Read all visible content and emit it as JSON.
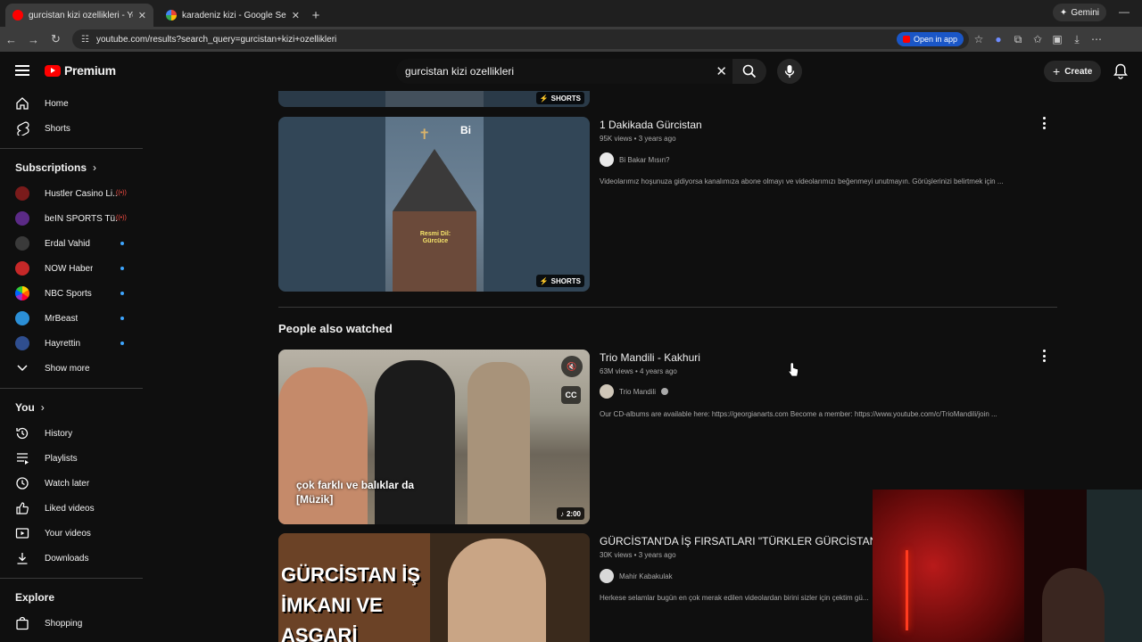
{
  "browser": {
    "tabs": [
      {
        "title": "gurcistan kizi ozellikleri - YouTube",
        "active": true
      },
      {
        "title": "karadeniz kizi - Google Search",
        "active": false
      }
    ],
    "gemini_label": "Gemini",
    "url": "youtube.com/results?search_query=gurcistan+kizi+ozellikleri",
    "open_in_app": "Open in app"
  },
  "header": {
    "logo_text": "Premium",
    "search_value": "gurcistan kizi ozellikleri",
    "create_label": "Create"
  },
  "sidebar": {
    "main": [
      {
        "label": "Home",
        "icon": "home-icon"
      },
      {
        "label": "Shorts",
        "icon": "shorts-icon"
      }
    ],
    "subscriptions_label": "Subscriptions",
    "subscriptions": [
      {
        "label": "Hustler Casino Li...",
        "color": "#7a1b1b",
        "status": "live"
      },
      {
        "label": "beIN SPORTS Tü...",
        "color": "#5b2a86",
        "status": "live"
      },
      {
        "label": "Erdal Vahid",
        "color": "#3a3a3a",
        "status": "new"
      },
      {
        "label": "NOW Haber",
        "color": "#c62828",
        "status": "new"
      },
      {
        "label": "NBC Sports",
        "color": "#2a2a2a",
        "status": "new"
      },
      {
        "label": "MrBeast",
        "color": "#2b8fd6",
        "status": "new"
      },
      {
        "label": "Hayrettin",
        "color": "#2f4e8f",
        "status": "new"
      }
    ],
    "show_more": "Show more",
    "you_label": "You",
    "you_items": [
      {
        "label": "History",
        "icon": "history-icon"
      },
      {
        "label": "Playlists",
        "icon": "playlists-icon"
      },
      {
        "label": "Watch later",
        "icon": "watch-later-icon"
      },
      {
        "label": "Liked videos",
        "icon": "like-icon"
      },
      {
        "label": "Your videos",
        "icon": "your-videos-icon"
      },
      {
        "label": "Downloads",
        "icon": "download-icon"
      }
    ],
    "explore_label": "Explore",
    "explore_items": [
      {
        "label": "Shopping",
        "icon": "shopping-icon"
      }
    ]
  },
  "results": {
    "shorts_badge": "SHORTS",
    "video1": {
      "title": "1 Dakikada Gürcistan",
      "meta": "95K views • 3 years ago",
      "channel": "Bi Bakar Mısın?",
      "description": "Videolarımız hoşunuza gidiyorsa kanalımıza abone olmayı ve videolarımızı beğenmeyi unutmayın. Görüşlerinizi belirtmek için ...",
      "thumb_text_top": "Bi",
      "thumb_text_mid": "Resmi Dil: Gürcüce"
    },
    "section_title": "People also watched",
    "video2": {
      "title": "Trio Mandili - Kakhuri",
      "meta": "63M views • 4 years ago",
      "channel": "Trio Mandili",
      "description": "Our CD-albums are available here: https://georgianarts.com Become a member: https://www.youtube.com/c/TrioMandili/join ...",
      "caption": "çok farklı ve balıklar da [Müzik]",
      "duration": "2:00",
      "cc": "CC"
    },
    "video3": {
      "title": "GÜRCİSTAN'DA İŞ FIRSATLARI \"TÜRKLER GÜRCİSTAN'DA",
      "meta": "30K views • 3 years ago",
      "channel": "Mahir Kabakulak",
      "description": "Herkese selamlar bugün en çok merak edilen videolardan birini sizler için çektim gü...",
      "thumb_text": "GÜRCİSTAN İŞ İMKANI VE ASGARİ"
    }
  },
  "colors": {
    "youtube_red": "#ff0000",
    "link_blue": "#3ea6ff",
    "open_app_blue": "#1a56c7"
  }
}
